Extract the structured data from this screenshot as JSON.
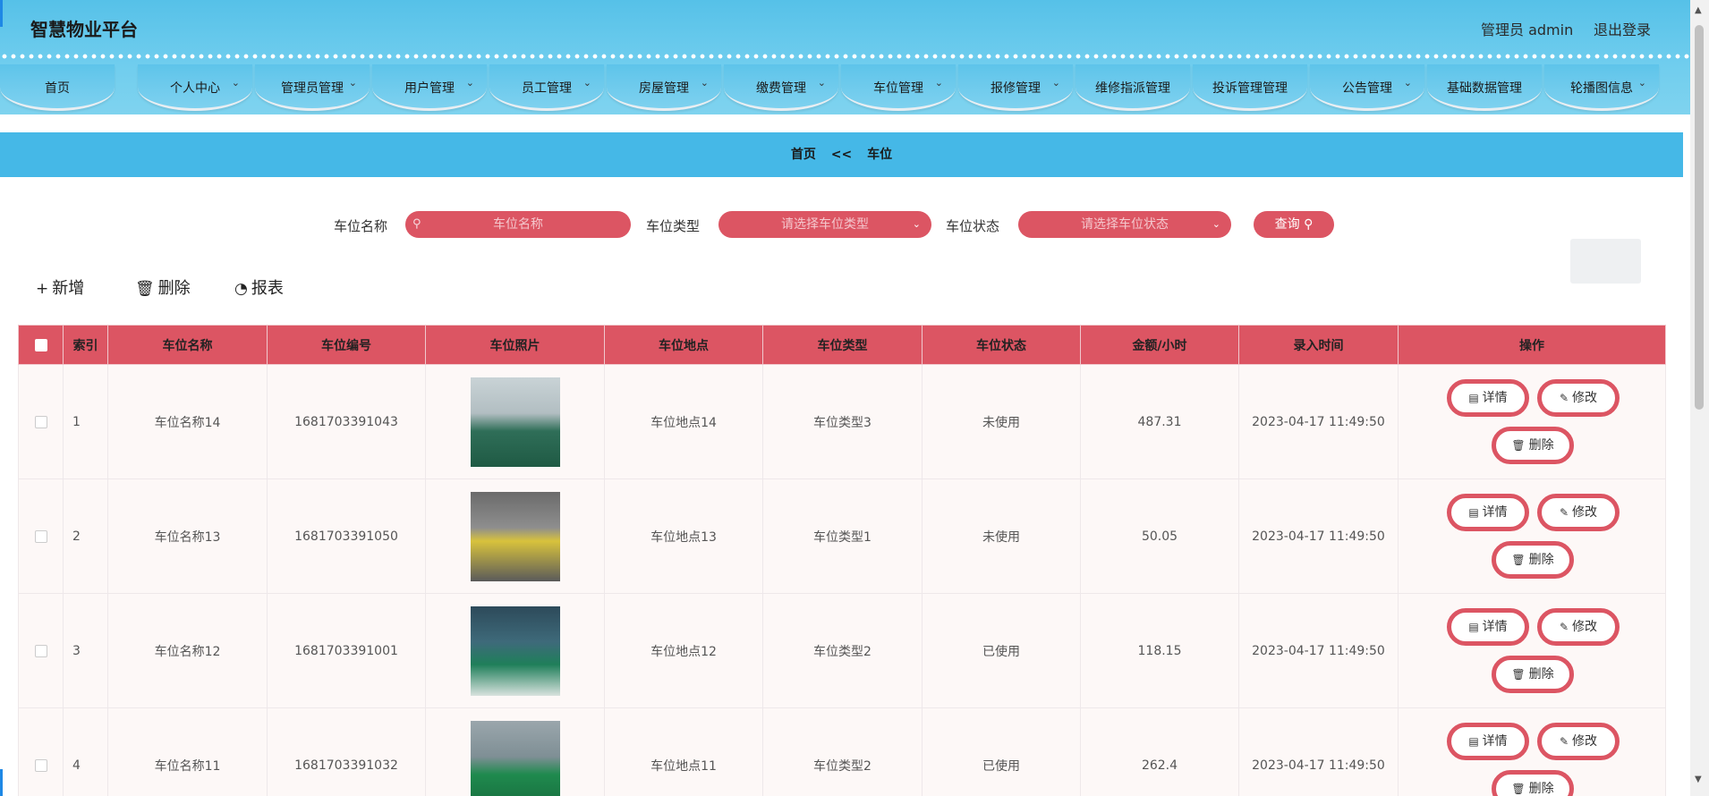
{
  "header": {
    "brand": "智慧物业平台",
    "user": "管理员 admin",
    "logout": "退出登录"
  },
  "nav": [
    {
      "label": "首页",
      "chevron": false
    },
    {
      "label": "个人中心",
      "chevron": true
    },
    {
      "label": "管理员管理",
      "chevron": true
    },
    {
      "label": "用户管理",
      "chevron": true
    },
    {
      "label": "员工管理",
      "chevron": true
    },
    {
      "label": "房屋管理",
      "chevron": true
    },
    {
      "label": "缴费管理",
      "chevron": true
    },
    {
      "label": "车位管理",
      "chevron": true
    },
    {
      "label": "报修管理",
      "chevron": true
    },
    {
      "label": "维修指派管理",
      "chevron": false
    },
    {
      "label": "投诉管理管理",
      "chevron": false
    },
    {
      "label": "公告管理",
      "chevron": true
    },
    {
      "label": "基础数据管理",
      "chevron": false
    },
    {
      "label": "轮播图信息",
      "chevron": true
    }
  ],
  "breadcrumb": {
    "home": "首页",
    "sep": "<<",
    "current": "车位"
  },
  "search": {
    "name_label": "车位名称",
    "name_placeholder": "车位名称",
    "type_label": "车位类型",
    "type_placeholder": "请选择车位类型",
    "status_label": "车位状态",
    "status_placeholder": "请选择车位状态",
    "query": "查询"
  },
  "toolbar": {
    "add": "新增",
    "delete": "删除",
    "report": "报表"
  },
  "table": {
    "headers": [
      "索引",
      "车位名称",
      "车位编号",
      "车位照片",
      "车位地点",
      "车位类型",
      "车位状态",
      "金额/小时",
      "录入时间",
      "操作"
    ],
    "rows": [
      {
        "index": "1",
        "name": "车位名称14",
        "code": "1681703391043",
        "location": "车位地点14",
        "type": "车位类型3",
        "status": "未使用",
        "price": "487.31",
        "time": "2023-04-17 11:49:50"
      },
      {
        "index": "2",
        "name": "车位名称13",
        "code": "1681703391050",
        "location": "车位地点13",
        "type": "车位类型1",
        "status": "未使用",
        "price": "50.05",
        "time": "2023-04-17 11:49:50"
      },
      {
        "index": "3",
        "name": "车位名称12",
        "code": "1681703391001",
        "location": "车位地点12",
        "type": "车位类型2",
        "status": "已使用",
        "price": "118.15",
        "time": "2023-04-17 11:49:50"
      },
      {
        "index": "4",
        "name": "车位名称11",
        "code": "1681703391032",
        "location": "车位地点11",
        "type": "车位类型2",
        "status": "已使用",
        "price": "262.4",
        "time": "2023-04-17 11:49:50"
      }
    ],
    "actions": {
      "detail": "详情",
      "edit": "修改",
      "delete": "删除"
    }
  },
  "colors": {
    "accent": "#dc5563",
    "header_blue": "#45b8e7"
  }
}
